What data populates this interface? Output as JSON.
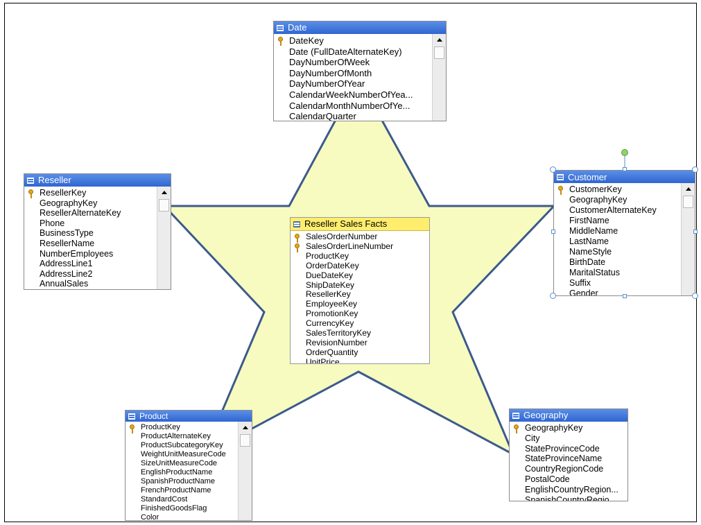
{
  "colors": {
    "star_fill": "#f7fbbf",
    "star_stroke": "#3c5a8c",
    "header_blue": "#3a71d8",
    "fact_header": "#ffee6e"
  },
  "tables": {
    "date": {
      "title": "Date",
      "fields": [
        {
          "name": "DateKey",
          "key": true
        },
        {
          "name": "Date (FullDateAlternateKey)"
        },
        {
          "name": "DayNumberOfWeek"
        },
        {
          "name": "DayNumberOfMonth"
        },
        {
          "name": "DayNumberOfYear"
        },
        {
          "name": "CalendarWeekNumberOfYea..."
        },
        {
          "name": "CalendarMonthNumberOfYe..."
        },
        {
          "name": "CalendarQuarter"
        }
      ]
    },
    "reseller": {
      "title": "Reseller",
      "fields": [
        {
          "name": "ResellerKey",
          "key": true
        },
        {
          "name": "GeographyKey"
        },
        {
          "name": "ResellerAlternateKey"
        },
        {
          "name": "Phone"
        },
        {
          "name": "BusinessType"
        },
        {
          "name": "ResellerName"
        },
        {
          "name": "NumberEmployees"
        },
        {
          "name": "AddressLine1"
        },
        {
          "name": "AddressLine2"
        },
        {
          "name": "AnnualSales"
        }
      ]
    },
    "customer": {
      "title": "Customer",
      "fields": [
        {
          "name": "CustomerKey",
          "key": true
        },
        {
          "name": "GeographyKey"
        },
        {
          "name": "CustomerAlternateKey"
        },
        {
          "name": "FirstName"
        },
        {
          "name": "MiddleName"
        },
        {
          "name": "LastName"
        },
        {
          "name": "NameStyle"
        },
        {
          "name": "BirthDate"
        },
        {
          "name": "MaritalStatus"
        },
        {
          "name": "Suffix"
        },
        {
          "name": "Gender"
        }
      ]
    },
    "facts": {
      "title": "Reseller Sales Facts",
      "fields": [
        {
          "name": "SalesOrderNumber",
          "key": true
        },
        {
          "name": "SalesOrderLineNumber",
          "key": true
        },
        {
          "name": "ProductKey"
        },
        {
          "name": "OrderDateKey"
        },
        {
          "name": "DueDateKey"
        },
        {
          "name": "ShipDateKey"
        },
        {
          "name": "ResellerKey"
        },
        {
          "name": "EmployeeKey"
        },
        {
          "name": "PromotionKey"
        },
        {
          "name": "CurrencyKey"
        },
        {
          "name": "SalesTerritoryKey"
        },
        {
          "name": "RevisionNumber"
        },
        {
          "name": "OrderQuantity"
        },
        {
          "name": "UnitPrice"
        }
      ]
    },
    "product": {
      "title": "Product",
      "fields": [
        {
          "name": "ProductKey",
          "key": true
        },
        {
          "name": "ProductAlternateKey"
        },
        {
          "name": "ProductSubcategoryKey"
        },
        {
          "name": "WeightUnitMeasureCode"
        },
        {
          "name": "SizeUnitMeasureCode"
        },
        {
          "name": "EnglishProductName"
        },
        {
          "name": "SpanishProductName"
        },
        {
          "name": "FrenchProductName"
        },
        {
          "name": "StandardCost"
        },
        {
          "name": "FinishedGoodsFlag"
        },
        {
          "name": "Color"
        }
      ]
    },
    "geography": {
      "title": "Geography",
      "fields": [
        {
          "name": "GeographyKey",
          "key": true
        },
        {
          "name": "City"
        },
        {
          "name": "StateProvinceCode"
        },
        {
          "name": "StateProvinceName"
        },
        {
          "name": "CountryRegionCode"
        },
        {
          "name": "PostalCode"
        },
        {
          "name": "EnglishCountryRegion..."
        },
        {
          "name": "SpanishCountryRegio..."
        }
      ]
    }
  }
}
